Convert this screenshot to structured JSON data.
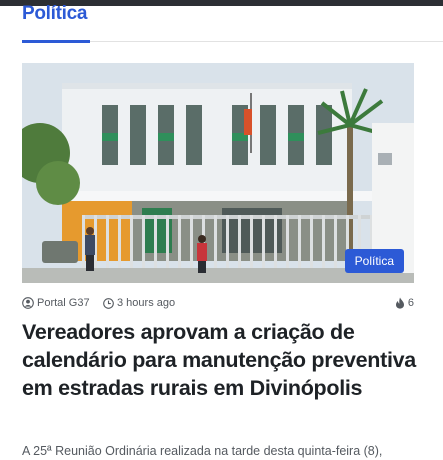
{
  "section": {
    "title": "Política"
  },
  "article": {
    "category": "Política",
    "author": "Portal G37",
    "time": "3 hours ago",
    "views": "6",
    "title": "Vereadores aprovam a criação de calendário para manutenção preventiva em estradas rurais em Divinópolis",
    "excerpt": "A 25ª Reunião Ordinária realizada na tarde desta quinta-feira (8),"
  },
  "icons": {
    "author": "user-icon",
    "time": "clock-icon",
    "views": "fire-icon"
  },
  "colors": {
    "accent": "#2c5ad6",
    "text": "#1e2226",
    "meta": "#555a60",
    "topbar": "#2c2f34"
  }
}
